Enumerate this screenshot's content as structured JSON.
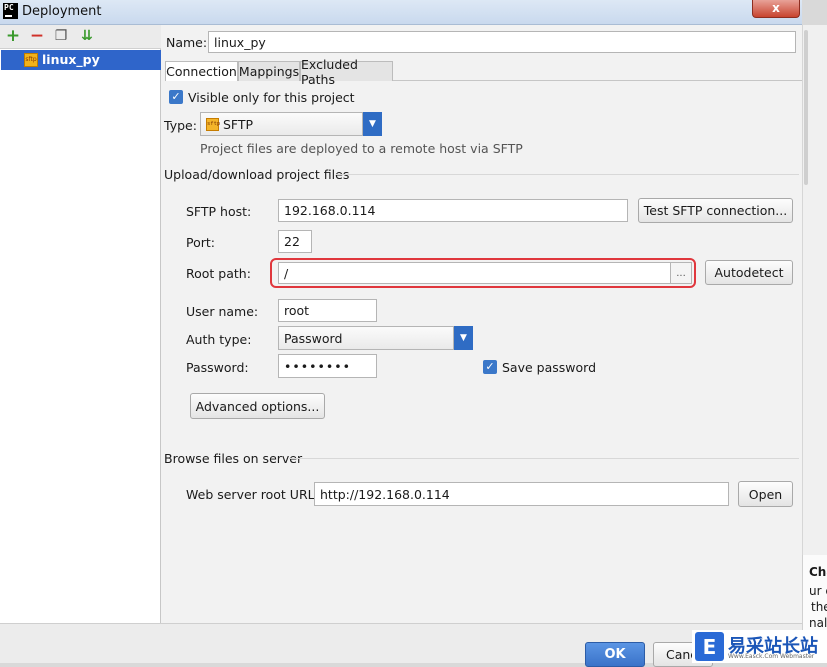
{
  "window": {
    "app_icon_text": "PC",
    "title": "Deployment",
    "close_label": "x"
  },
  "sidebar": {
    "toolbar": {
      "add": "+",
      "remove": "−",
      "copy": "❐",
      "move": "⇊"
    },
    "items": [
      {
        "label": "linux_py",
        "icon": "sftp-server-icon",
        "icon_text": "sftp"
      }
    ]
  },
  "form": {
    "name_label": "Name:",
    "name_value": "linux_py",
    "tabs": [
      {
        "label": "Connection",
        "active": true
      },
      {
        "label": "Mappings",
        "active": false
      },
      {
        "label": "Excluded Paths",
        "active": false
      }
    ],
    "visible_only_label": "Visible only for this project",
    "visible_only_checked": true,
    "type_label": "Type:",
    "type_value": "SFTP",
    "type_icon_text": "sftp",
    "type_hint": "Project files are deployed to a remote host via SFTP",
    "upload_section": "Upload/download project files",
    "sftp_host_label": "SFTP host:",
    "sftp_host_value": "192.168.0.114",
    "test_button": "Test SFTP connection...",
    "port_label": "Port:",
    "port_value": "22",
    "root_path_label": "Root path:",
    "root_path_value": "/",
    "browse_button": "...",
    "autodetect_button": "Autodetect",
    "username_label": "User name:",
    "username_value": "root",
    "auth_type_label": "Auth type:",
    "auth_type_value": "Password",
    "password_label": "Password:",
    "password_value": "••••••••",
    "save_password_label": "Save password",
    "save_password_checked": true,
    "advanced_button": "Advanced options...",
    "browse_section": "Browse files on server",
    "web_root_label": "Web server root URL:",
    "web_root_value": "http://192.168.0.114",
    "open_button": "Open"
  },
  "footer": {
    "ok_button": "OK",
    "cancel_button": "Canc"
  },
  "background_window": {
    "lines": [
      "Cha",
      "ur e",
      "the",
      "nal c"
    ]
  },
  "watermark": {
    "logo_letter": "E",
    "text": "易采站长站",
    "subtext": "Www.Easck.Com  Webmaster"
  },
  "colors": {
    "accent": "#2f6cc4",
    "selection": "#2f65ca",
    "highlight_border": "#e0373d"
  }
}
